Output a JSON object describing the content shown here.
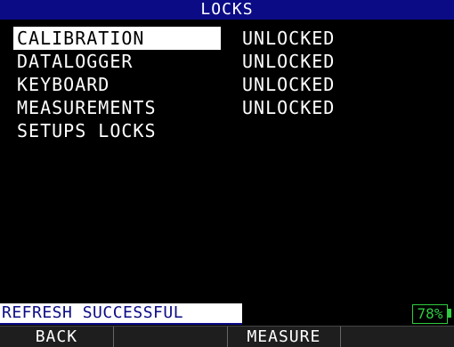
{
  "title": "LOCKS",
  "menu": {
    "items": [
      {
        "label": "CALIBRATION",
        "value": "UNLOCKED",
        "selected": true
      },
      {
        "label": "DATALOGGER",
        "value": "UNLOCKED",
        "selected": false
      },
      {
        "label": "KEYBOARD",
        "value": "UNLOCKED",
        "selected": false
      },
      {
        "label": "MEASUREMENTS",
        "value": "UNLOCKED",
        "selected": false
      },
      {
        "label": "SETUPS LOCKS",
        "value": "",
        "selected": false
      }
    ]
  },
  "status": {
    "message": "REFRESH SUCCESSFUL",
    "battery": "78%"
  },
  "softkeys": [
    "BACK",
    "",
    "MEASURE",
    ""
  ],
  "colors": {
    "title_bg": "#0b0b86",
    "battery": "#2ecc40",
    "background": "#000000"
  }
}
